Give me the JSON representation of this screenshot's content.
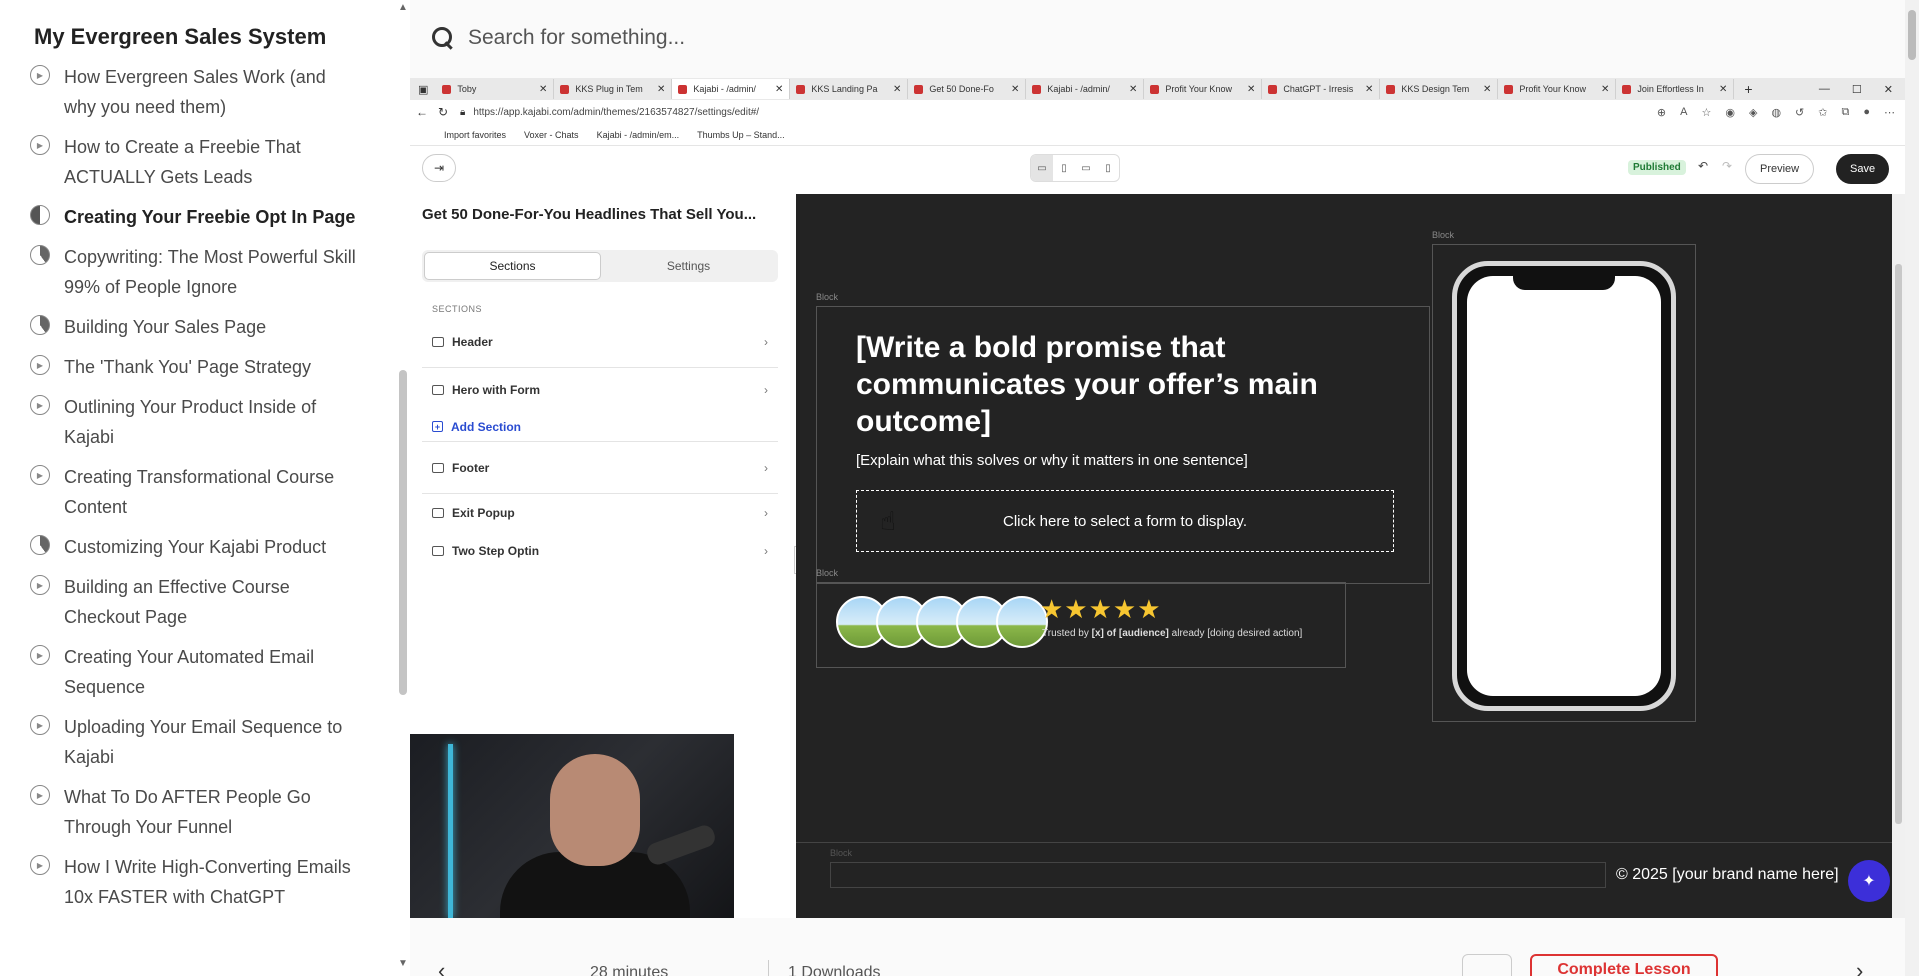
{
  "course": {
    "title": "My Evergreen Sales System",
    "lessons": [
      {
        "label": "How Evergreen Sales Work (and why you need them)",
        "state": "play"
      },
      {
        "label": "How to Create a Freebie That ACTUALLY Gets Leads",
        "state": "play"
      },
      {
        "label": "Creating Your Freebie Opt In Page",
        "state": "active"
      },
      {
        "label": "Copywriting: The Most Powerful Skill 99% of People Ignore",
        "state": "partial"
      },
      {
        "label": "Building Your Sales Page",
        "state": "partial"
      },
      {
        "label": "The 'Thank You' Page Strategy",
        "state": "play"
      },
      {
        "label": "Outlining Your Product Inside of Kajabi",
        "state": "play"
      },
      {
        "label": "Creating Transformational Course Content",
        "state": "play"
      },
      {
        "label": "Customizing Your Kajabi Product",
        "state": "partial"
      },
      {
        "label": "Building an Effective Course Checkout Page",
        "state": "play"
      },
      {
        "label": "Creating Your Automated Email Sequence",
        "state": "play"
      },
      {
        "label": "Uploading Your Email Sequence to Kajabi",
        "state": "play"
      },
      {
        "label": "What To Do AFTER People Go Through Your Funnel",
        "state": "play"
      },
      {
        "label": "How I Write High-Converting Emails 10x FASTER with ChatGPT",
        "state": "play"
      }
    ]
  },
  "search": {
    "placeholder": "Search for something..."
  },
  "browser": {
    "tabs": [
      "Toby",
      "KKS Plug in Tem",
      "Kajabi - /admin/",
      "KKS Landing Pa",
      "Get 50 Done-Fo",
      "Kajabi - /admin/",
      "Profit Your Know",
      "ChatGPT - Irresis",
      "KKS Design Tem",
      "Profit Your Know",
      "Join Effortless In"
    ],
    "url": "https://app.kajabi.com/admin/themes/2163574827/settings/edit#/",
    "bookmarks": [
      "Import favorites",
      "Voxer - Chats",
      "Kajabi - /admin/em...",
      "Thumbs Up – Stand..."
    ]
  },
  "editor": {
    "status": "Published",
    "preview_label": "Preview",
    "save_label": "Save",
    "page_title": "Get 50 Done-For-You Headlines That Sell You...",
    "tabs": {
      "sections": "Sections",
      "settings": "Settings"
    },
    "sections_heading": "SECTIONS",
    "sections": {
      "header": "Header",
      "hero": "Hero with Form",
      "add": "Add Section",
      "footer": "Footer",
      "exit_popup": "Exit Popup",
      "two_step": "Two Step Optin"
    }
  },
  "canvas": {
    "block_label": "Block",
    "headline": "[Write a bold promise that communicates your offer’s main outcome]",
    "subhead": "[Explain what this solves or why it matters in one sentence]",
    "form_placeholder": "Click here to select a form to display.",
    "stars": "★★★★★",
    "trusted_prefix": "Trusted by ",
    "trusted_bold": "[x] of [audience]",
    "trusted_suffix": " already [doing desired action]",
    "copyright": "© 2025 [your brand name here]"
  },
  "bottom": {
    "duration": "28 minutes",
    "downloads": "1 Downloads",
    "complete_label": "Complete Lesson"
  }
}
